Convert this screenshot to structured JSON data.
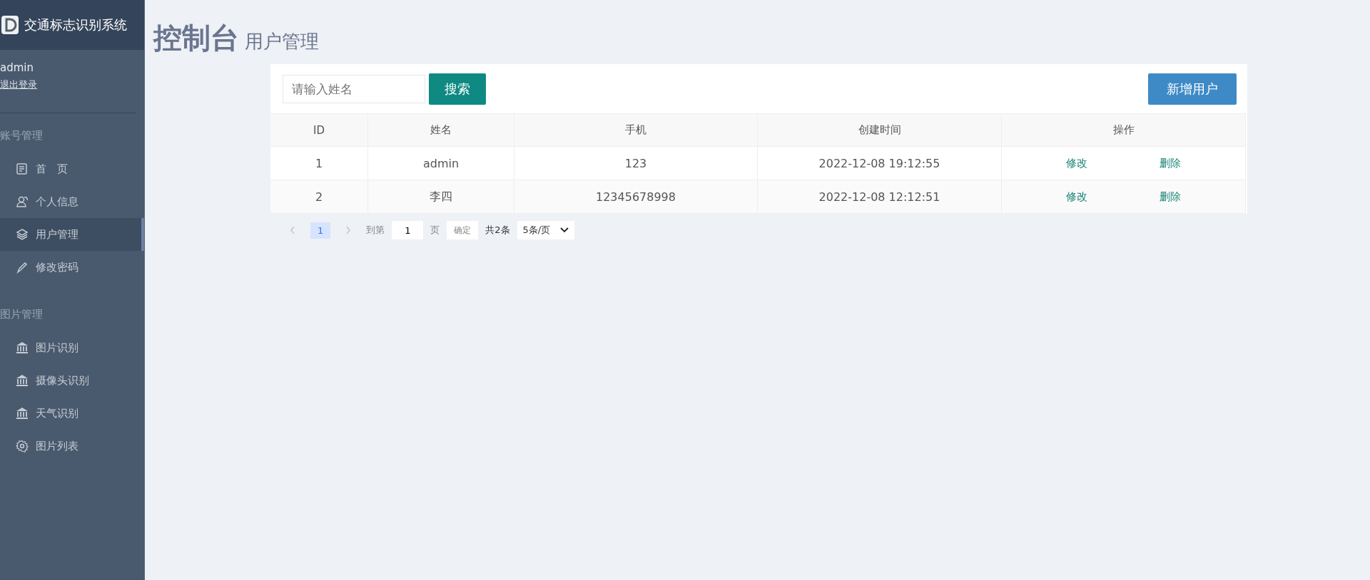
{
  "sidebar": {
    "app_title": "交通标志识别系统",
    "user": "admin",
    "logout": "退出登录",
    "groups": [
      {
        "title": "账号管理",
        "items": [
          {
            "label": "首　页",
            "kind": "doc",
            "selected": false
          },
          {
            "label": "个人信息",
            "kind": "user",
            "selected": false
          },
          {
            "label": "用户管理",
            "kind": "layers",
            "selected": true
          },
          {
            "label": "修改密码",
            "kind": "pen",
            "selected": false
          }
        ]
      },
      {
        "title": "图片管理",
        "items": [
          {
            "label": "图片识别",
            "kind": "bank",
            "selected": false
          },
          {
            "label": "摄像头识别",
            "kind": "bank",
            "selected": false
          },
          {
            "label": "天气识别",
            "kind": "bank",
            "selected": false
          },
          {
            "label": "图片列表",
            "kind": "gear",
            "selected": false
          }
        ]
      }
    ]
  },
  "header": {
    "title": "控制台",
    "subtitle": "用户管理"
  },
  "toolbar": {
    "search": {
      "placeholder": "请输入姓名"
    },
    "search_button": "搜索",
    "add_button": "新增用户"
  },
  "table": {
    "columns": [
      "ID",
      "姓名",
      "手机",
      "创建时间",
      "操作"
    ],
    "rows": [
      {
        "id": "1",
        "name": "admin",
        "phone": "123",
        "created": "2022-12-08 19:12:55",
        "actions": [
          "修改",
          "删除"
        ]
      },
      {
        "id": "2",
        "name": "李四",
        "phone": "12345678998",
        "created": "2022-12-08 12:12:51",
        "actions": [
          "修改",
          "删除"
        ]
      }
    ]
  },
  "pagination": {
    "pages": [
      {
        "label": "1",
        "selected": true
      }
    ],
    "goto_label": "到第",
    "goto_value": "1",
    "page_unit": "页",
    "confirm": "确定",
    "total": "共2条",
    "page_size": "5条/页"
  }
}
